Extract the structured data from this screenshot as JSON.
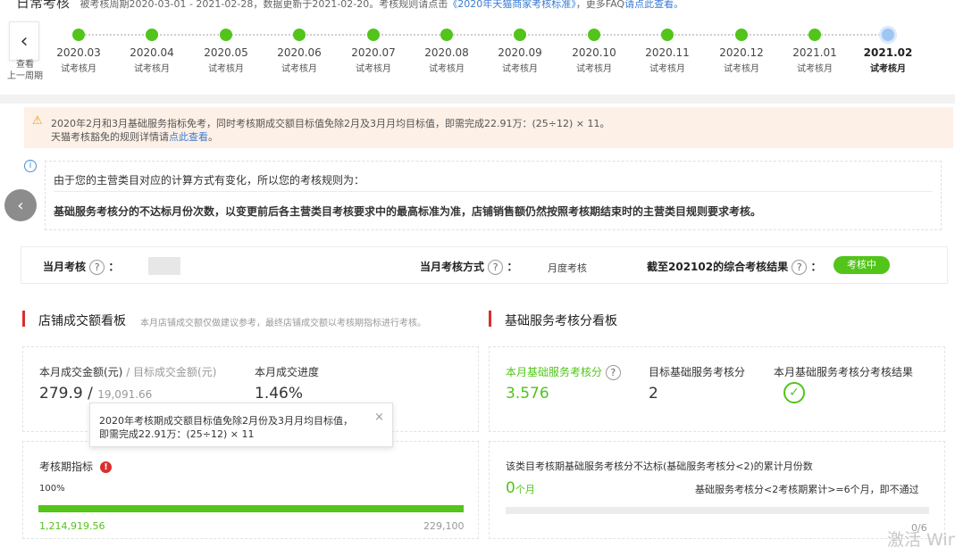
{
  "header": {
    "title_partial": "日常考核",
    "desc_partial": "被考核周期2020-03-01 - 2021-02-28，数据更新于2021-02-20。考核规则请点击",
    "rule_link": "《2020年天猫商家考核标准》",
    "faq_text": "，更多FAQ",
    "faq_link": "请点此查看。"
  },
  "timeline": {
    "back_label_1": "查看",
    "back_label_2": "上一周期",
    "nodes": [
      {
        "month": "2020.03",
        "sub": "试考核月"
      },
      {
        "month": "2020.04",
        "sub": "试考核月"
      },
      {
        "month": "2020.05",
        "sub": "试考核月"
      },
      {
        "month": "2020.06",
        "sub": "试考核月"
      },
      {
        "month": "2020.07",
        "sub": "试考核月"
      },
      {
        "month": "2020.08",
        "sub": "试考核月"
      },
      {
        "month": "2020.09",
        "sub": "试考核月"
      },
      {
        "month": "2020.10",
        "sub": "试考核月"
      },
      {
        "month": "2020.11",
        "sub": "试考核月"
      },
      {
        "month": "2020.12",
        "sub": "试考核月"
      },
      {
        "month": "2021.01",
        "sub": "试考核月"
      },
      {
        "month": "2021.02",
        "sub": "试考核月"
      }
    ]
  },
  "warning": {
    "line1": "2020年2月和3月基础服务指标免考，同时考核期成交额目标值免除2月及3月月均目标值，即需完成22.91万：(25÷12) × 11。",
    "line2_prefix": "天猫考核豁免的规则详情请",
    "line2_link": "点此查看",
    "line2_suffix": "。"
  },
  "info": {
    "line1": "由于您的主营类目对应的计算方式有变化，所以您的考核规则为：",
    "line2": "基础服务考核分的不达标月份次数，以变更前后各主营类目考核要求中的最高标准为准，店铺销售额仍然按照考核期结束时的主营类目规则要求考核。"
  },
  "status": {
    "monthly_label": "当月考核",
    "method_label": "当月考核方式",
    "method_value": "月度考核",
    "result_label": "截至202102的综合考核结果",
    "result_badge": "考核中",
    "colon": "："
  },
  "left_panel": {
    "title": "店铺成交额看板",
    "note": "本月店铺成交额仅做建议参考，最终店铺成交额以考核期指标进行考核。",
    "gmv_label": "本月成交金额(元)",
    "target_label": "/ 目标成交金额(元)",
    "gmv_value": "279.9",
    "slash": "/",
    "target_value": "19,091.66",
    "progress_label": "本月成交进度",
    "progress_value": "1.46%",
    "period_label": "考核期指标",
    "alert_glyph": "!",
    "period_percent": "100%",
    "period_progress": 1.0,
    "period_left_value": "1,214,919.56",
    "period_right_value": "229,100"
  },
  "tooltip": {
    "line1": "2020年考核期成交额目标值免除2月份及3月月均目标值，",
    "line2": "即需完成22.91万：(25÷12) × 11",
    "close": "×"
  },
  "right_panel": {
    "title": "基础服务考核分看板",
    "score_label": "本月基础服务考核分",
    "score_value": "3.576",
    "target_label": "目标基础服务考核分",
    "target_value": "2",
    "result_label": "本月基础服务考核分考核结果",
    "months_label": "该类目考核期基础服务考核分不达标(基础服务考核分<2)的累计月份数",
    "months_value": "0",
    "months_unit": "个月",
    "rule_text": "基础服务考核分<2考核期累计>=6个月，即不通过",
    "fraction": "0/6"
  },
  "icons": {
    "back": "‹",
    "left_arrow": "‹",
    "warn": "⚠",
    "info": "i",
    "question": "?",
    "check": "✓"
  },
  "watermark": "激活 Win",
  "colors": {
    "green": "#52c41a",
    "red": "#d9302c",
    "blue_link": "#3a7bd5",
    "warn_bg": "#fdf0e6"
  }
}
